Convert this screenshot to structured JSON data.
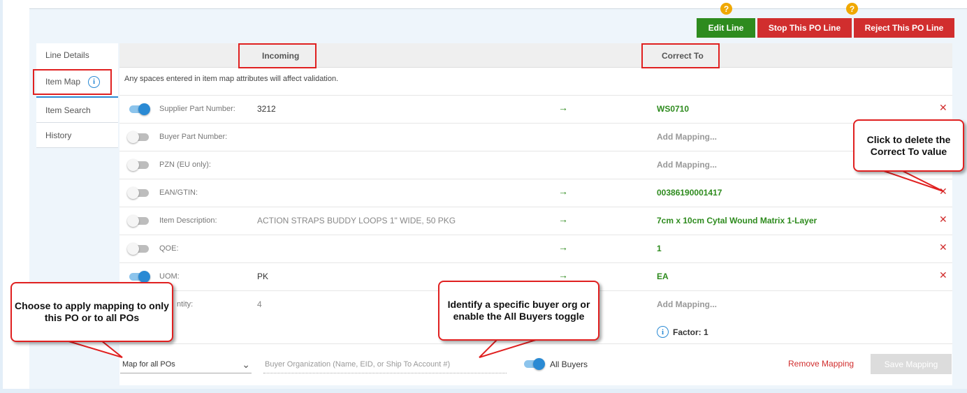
{
  "actions": {
    "edit_line": "Edit Line",
    "stop_line": "Stop This PO Line",
    "reject_line": "Reject This PO Line",
    "help_glyph": "?",
    "colors": {
      "green": "#2e8b1e",
      "red": "#d12e2e",
      "help": "#f0a800"
    }
  },
  "sidenav": {
    "items": [
      {
        "label": "Line Details"
      },
      {
        "label": "Item Map",
        "active": true
      },
      {
        "label": "Item Search"
      },
      {
        "label": "History"
      }
    ]
  },
  "table": {
    "col_incoming": "Incoming",
    "col_correct": "Correct To",
    "note": "Any spaces entered in item map attributes will affect validation.",
    "rows": [
      {
        "attribute": "Supplier Part Number:",
        "incoming": "3212",
        "correct": "WS0710",
        "toggle_on": true
      },
      {
        "attribute": "Buyer Part Number:",
        "incoming": "",
        "correct": "Add Mapping...",
        "toggle_on": false
      },
      {
        "attribute": "PZN (EU only):",
        "incoming": "",
        "correct": "Add Mapping...",
        "toggle_on": false
      },
      {
        "attribute": "EAN/GTIN:",
        "incoming": "",
        "correct": "00386190001417",
        "toggle_on": false
      },
      {
        "attribute": "Item Description:",
        "incoming": "ACTION STRAPS BUDDY LOOPS 1\" WIDE, 50 PKG",
        "correct": "7cm x 10cm Cytal Wound Matrix 1-Layer",
        "toggle_on": false
      },
      {
        "attribute": "QOE:",
        "incoming": "",
        "correct": "1",
        "toggle_on": false
      },
      {
        "attribute": "UOM:",
        "incoming": "PK",
        "correct": "EA",
        "toggle_on": true
      },
      {
        "attribute": "ntity:",
        "incoming": "4",
        "correct": "Add Mapping...",
        "toggle_on": false
      }
    ],
    "arrow_glyph": "→",
    "delete_glyph": "✕",
    "factor": "Factor: 1"
  },
  "footer": {
    "map_scope": "Map for all POs",
    "buyer_placeholder": "Buyer Organization (Name, EID, or Ship To Account #)",
    "all_buyers": "All Buyers",
    "remove_mapping": "Remove Mapping",
    "save_mapping": "Save Mapping"
  },
  "callouts": {
    "delete_value": "Click to delete the Correct To value",
    "map_scope": "Choose to apply mapping to only this PO or to all POs",
    "buyer_org": "Identify a specific buyer org or enable the All Buyers toggle"
  }
}
